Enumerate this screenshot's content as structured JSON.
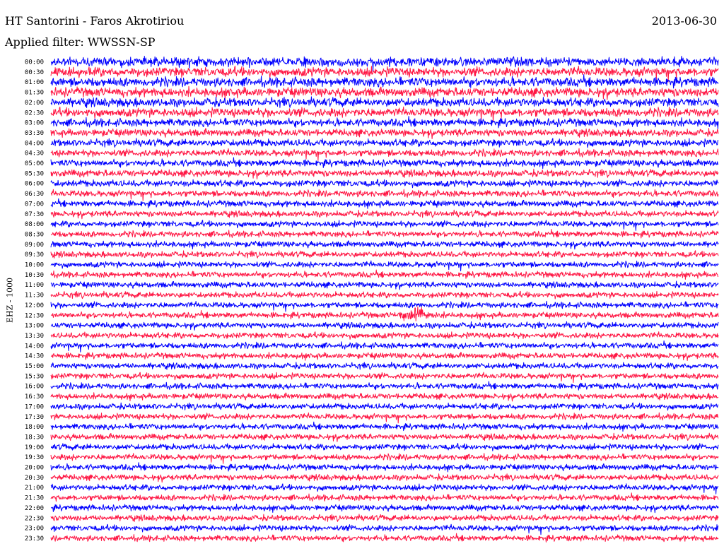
{
  "header": {
    "station": "HT Santorini - Faros Akrotiriou",
    "date": "2013-06-30",
    "filter_prefix": "Applied filter:",
    "filter_value": "WWSSN-SP"
  },
  "channel_label": "EHZ - 1000",
  "colors": {
    "trace_a": "#0000ff",
    "trace_b": "#ff1744",
    "background": "#ffffff",
    "text": "#000000"
  },
  "chart_data": {
    "type": "line",
    "title": "HT Santorini - Faros Akrotiriou",
    "subtitle": "Applied filter: WWSSN-SP",
    "ylabel": "EHZ - 1000",
    "row_labels": [
      "00:00",
      "00:30",
      "01:00",
      "01:30",
      "02:00",
      "02:30",
      "03:00",
      "03:30",
      "04:00",
      "04:30",
      "05:00",
      "05:30",
      "06:00",
      "06:30",
      "07:00",
      "07:30",
      "08:00",
      "08:30",
      "09:00",
      "09:30",
      "10:00",
      "10:30",
      "11:00",
      "11:30",
      "12:00",
      "12:30",
      "13:00",
      "13:30",
      "14:00",
      "14:30",
      "15:00",
      "15:30",
      "16:00",
      "16:30",
      "17:00",
      "17:30",
      "18:00",
      "18:30",
      "19:00",
      "19:30",
      "20:00",
      "20:30",
      "21:00",
      "21:30",
      "22:00",
      "22:30",
      "23:00",
      "23:30"
    ],
    "series": [
      {
        "color": "#0000ff",
        "rows": "00:00, 01:00, 02:00, ... (even rows)"
      },
      {
        "color": "#ff1744",
        "rows": "00:30, 01:30, 02:30, ... (odd rows)"
      }
    ],
    "relative_amplitude": [
      1.0,
      1.0,
      1.0,
      1.0,
      0.95,
      0.95,
      0.85,
      0.8,
      0.78,
      0.75,
      0.75,
      0.75,
      0.72,
      0.7,
      0.68,
      0.66,
      0.65,
      0.65,
      0.65,
      0.65,
      0.64,
      0.64,
      0.64,
      0.64,
      0.64,
      0.64,
      0.64,
      0.64,
      0.64,
      0.64,
      0.64,
      0.64,
      0.64,
      0.64,
      0.64,
      0.64,
      0.64,
      0.64,
      0.64,
      0.64,
      0.64,
      0.64,
      0.64,
      0.64,
      0.64,
      0.64,
      0.64,
      0.64
    ],
    "events": [
      {
        "row": "12:30",
        "minute": 16.5,
        "peak_amplitude": 2.4
      }
    ]
  }
}
